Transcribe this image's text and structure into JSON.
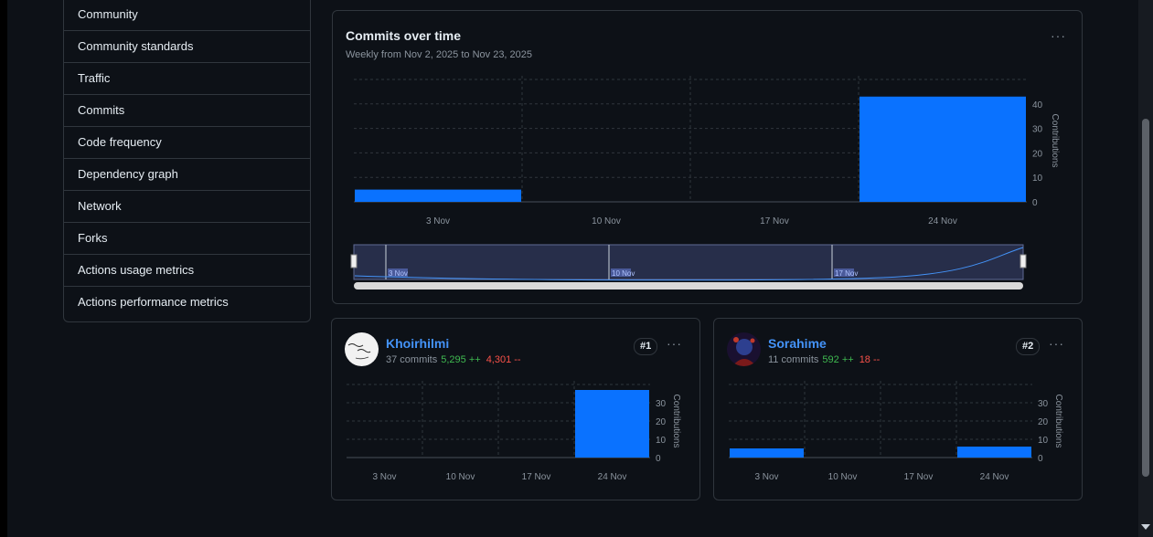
{
  "sidebar": {
    "items": [
      {
        "label": "Community"
      },
      {
        "label": "Community standards"
      },
      {
        "label": "Traffic"
      },
      {
        "label": "Commits"
      },
      {
        "label": "Code frequency"
      },
      {
        "label": "Dependency graph"
      },
      {
        "label": "Network"
      },
      {
        "label": "Forks"
      },
      {
        "label": "Actions usage metrics"
      },
      {
        "label": "Actions performance metrics"
      }
    ]
  },
  "main_chart": {
    "title": "Commits over time",
    "subtitle": "Weekly from Nov 2, 2025 to Nov 23, 2025",
    "menu_icon": "kebab-horizontal-icon"
  },
  "contributors": [
    {
      "name": "Khoirhilmi",
      "commits": "37 commits",
      "additions": "5,295 ++",
      "deletions": "4,301 --",
      "rank": "#1"
    },
    {
      "name": "Sorahime",
      "commits": "11 commits",
      "additions": "592 ++",
      "deletions": "18 --",
      "rank": "#2"
    }
  ],
  "colors": {
    "bar": "#0a72ff",
    "link": "#4493f8",
    "additions": "#3fb950",
    "deletions": "#f85149",
    "grid": "#30363d"
  },
  "chart_data": [
    {
      "type": "bar",
      "categories": [
        "3 Nov",
        "10 Nov",
        "17 Nov",
        "24 Nov"
      ],
      "values": [
        5,
        0,
        0,
        43
      ],
      "ylabel": "Contributions",
      "yticks": [
        0,
        10,
        20,
        30,
        40
      ],
      "ylim": [
        0,
        50
      ],
      "navigator_labels": [
        "3 Nov",
        "10 Nov",
        "17 Nov"
      ]
    },
    {
      "type": "bar",
      "categories": [
        "3 Nov",
        "10 Nov",
        "17 Nov",
        "24 Nov"
      ],
      "values": [
        0,
        0,
        0,
        37
      ],
      "ylabel": "Contributions",
      "yticks": [
        0,
        10,
        20,
        30
      ],
      "ylim": [
        0,
        40
      ]
    },
    {
      "type": "bar",
      "categories": [
        "3 Nov",
        "10 Nov",
        "17 Nov",
        "24 Nov"
      ],
      "values": [
        5,
        0,
        0,
        6
      ],
      "ylabel": "Contributions",
      "yticks": [
        0,
        10,
        20,
        30
      ],
      "ylim": [
        0,
        40
      ]
    }
  ]
}
